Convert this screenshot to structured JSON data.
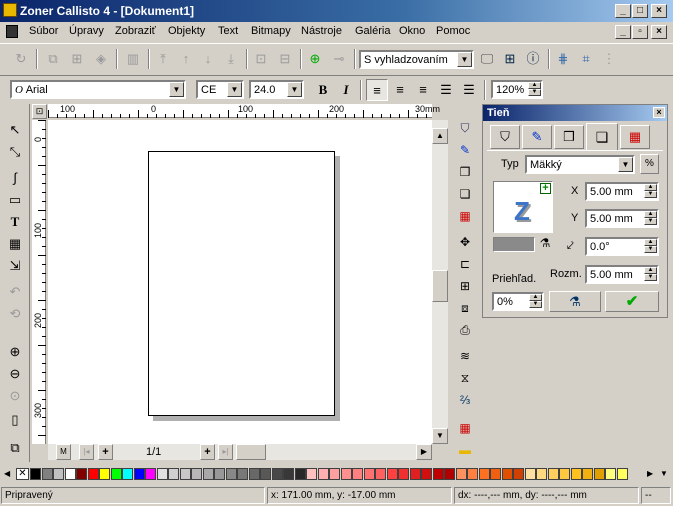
{
  "window": {
    "title": "Zoner Callisto 4 - [Dokument1]"
  },
  "menu": [
    "Súbor",
    "Úpravy",
    "Zobraziť",
    "Objekty",
    "Text",
    "Bitmapy",
    "Nástroje",
    "Galéria",
    "Okno",
    "Pomoc"
  ],
  "toolbar": {
    "smoothing_mode": "S vyhladzovaním"
  },
  "format_bar": {
    "font": "Arial",
    "charset": "CE",
    "size": "24.0",
    "bold": "B",
    "italic": "I",
    "zoom": "120%"
  },
  "rulers": {
    "h_labels": [
      "100",
      "0",
      "100",
      "200",
      "30mm"
    ],
    "v_labels": [
      "0",
      "100",
      "200",
      "300"
    ]
  },
  "page_nav": {
    "first": "M",
    "add": "+",
    "indicator": "1/1",
    "add2": "+"
  },
  "shadow_panel": {
    "title": "Tieň",
    "type_label": "Typ",
    "type_value": "Mäkký",
    "percent_btn": "%",
    "preview_letter": "Z",
    "x_label": "X",
    "x_value": "5.00 mm",
    "y_label": "Y",
    "y_value": "5.00 mm",
    "angle_value": "0.0°",
    "transparency_label": "Priehľad.",
    "blur_label": "Rozm.",
    "blur_value": "5.00 mm",
    "transparency_value": "0%",
    "apply_check": "✔"
  },
  "palette": {
    "colors": [
      "#000000",
      "#808080",
      "#c0c0c0",
      "#ffffff",
      "#800000",
      "#ff0000",
      "#ffff00",
      "#00ff00",
      "#00ffff",
      "#0000ff",
      "#ff00ff",
      "#e0e0e0",
      "#d0d0d0",
      "#c8c8c8",
      "#b8b8b8",
      "#a8a8a8",
      "#989898",
      "#888888",
      "#787878",
      "#686868",
      "#585858",
      "#484848",
      "#383838",
      "#282828",
      "#ffc0c0",
      "#ffb0b0",
      "#ffa0a0",
      "#ff9090",
      "#ff8080",
      "#ff7070",
      "#ff6060",
      "#ff4040",
      "#f03030",
      "#e02020",
      "#d01010",
      "#c00000",
      "#b00000",
      "#ff9060",
      "#ff8040",
      "#ff7020",
      "#f06010",
      "#e05000",
      "#d04000",
      "#ffe0a0",
      "#ffd880",
      "#ffd060",
      "#ffc840",
      "#ffc020",
      "#f0b010",
      "#e0a000",
      "#ffff80",
      "#ffff60"
    ]
  },
  "status": {
    "message": "Pripravený",
    "coords": "x: 171.00 mm, y: -17.00 mm",
    "delta": "dx: ----,--- mm, dy: ----,--- mm",
    "extra": "--"
  }
}
